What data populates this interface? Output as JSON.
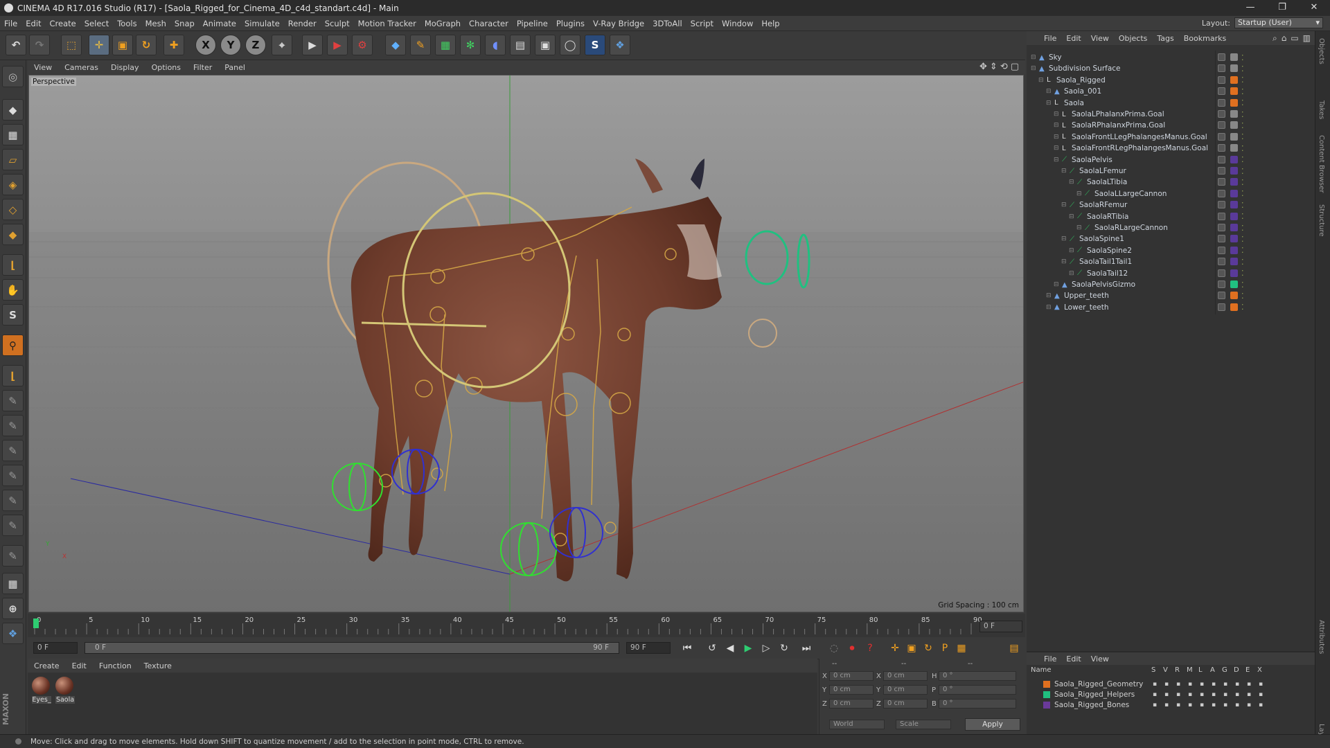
{
  "window": {
    "title": "CINEMA 4D R17.016 Studio (R17) - [Saola_Rigged_for_Cinema_4D_c4d_standart.c4d] - Main"
  },
  "menu": [
    "File",
    "Edit",
    "Create",
    "Select",
    "Tools",
    "Mesh",
    "Snap",
    "Animate",
    "Simulate",
    "Render",
    "Sculpt",
    "Motion Tracker",
    "MoGraph",
    "Character",
    "Pipeline",
    "Plugins",
    "V-Ray Bridge",
    "3DToAll",
    "Script",
    "Window",
    "Help"
  ],
  "layout": {
    "label": "Layout:",
    "value": "Startup (User)"
  },
  "toolbar": {
    "x": "X",
    "y": "Y",
    "z": "Z"
  },
  "viewport": {
    "menu": [
      "View",
      "Cameras",
      "Display",
      "Options",
      "Filter",
      "Panel"
    ],
    "label": "Perspective",
    "grid_spacing": "Grid Spacing : 100 cm",
    "axis_y": "Y",
    "axis_x": "X",
    "axis_z": "Z"
  },
  "timeline": {
    "ticks": [
      "0",
      "5",
      "10",
      "15",
      "20",
      "25",
      "30",
      "35",
      "40",
      "45",
      "50",
      "55",
      "60",
      "65",
      "70",
      "75",
      "80",
      "85",
      "90"
    ],
    "current_frame": "0 F",
    "field_start": "0 F",
    "slider_start": "0 F",
    "slider_end": "90 F",
    "field_end": "90 F"
  },
  "materials": {
    "menu": [
      "Create",
      "Edit",
      "Function",
      "Texture"
    ],
    "items": [
      {
        "name": "Eyes_"
      },
      {
        "name": "Saola"
      }
    ]
  },
  "coords": {
    "header1": "--",
    "header2": "--",
    "header3": "--",
    "rows": [
      {
        "l1": "X",
        "v1": "0 cm",
        "l2": "X",
        "v2": "0 cm",
        "l3": "H",
        "v3": "0 °"
      },
      {
        "l1": "Y",
        "v1": "0 cm",
        "l2": "Y",
        "v2": "0 cm",
        "l3": "P",
        "v3": "0 °"
      },
      {
        "l1": "Z",
        "v1": "0 cm",
        "l2": "Z",
        "v2": "0 cm",
        "l3": "B",
        "v3": "0 °"
      }
    ],
    "world": "World",
    "scale": "Scale",
    "apply": "Apply"
  },
  "objects": {
    "menu": [
      "File",
      "Edit",
      "View",
      "Objects",
      "Tags",
      "Bookmarks"
    ],
    "tree": [
      {
        "name": "Sky",
        "indent": 0,
        "color": "#888888",
        "icon": "sky-icon"
      },
      {
        "name": "Subdivision Surface",
        "indent": 0,
        "color": "#888888",
        "icon": "subdivision-icon"
      },
      {
        "name": "Saola_Rigged",
        "indent": 1,
        "color": "#e07020",
        "icon": "null-icon"
      },
      {
        "name": "Saola_001",
        "indent": 2,
        "color": "#e07020",
        "icon": "polygon-icon"
      },
      {
        "name": "Saola",
        "indent": 2,
        "color": "#e07020",
        "icon": "null-icon"
      },
      {
        "name": "SaolaLPhalanxPrima.Goal",
        "indent": 3,
        "color": "#888888",
        "icon": "null-icon"
      },
      {
        "name": "SaolaRPhalanxPrima.Goal",
        "indent": 3,
        "color": "#888888",
        "icon": "null-icon"
      },
      {
        "name": "SaolaFrontLLegPhalangesManus.Goal",
        "indent": 3,
        "color": "#888888",
        "icon": "null-icon"
      },
      {
        "name": "SaolaFrontRLegPhalangesManus.Goal",
        "indent": 3,
        "color": "#888888",
        "icon": "null-icon"
      },
      {
        "name": "SaolaPelvis",
        "indent": 3,
        "color": "#5a3a9a",
        "icon": "joint-icon"
      },
      {
        "name": "SaolaLFemur",
        "indent": 4,
        "color": "#5a3a9a",
        "icon": "joint-icon"
      },
      {
        "name": "SaolaLTibia",
        "indent": 5,
        "color": "#5a3a9a",
        "icon": "joint-icon"
      },
      {
        "name": "SaolaLLargeCannon",
        "indent": 6,
        "color": "#5a3a9a",
        "icon": "joint-icon"
      },
      {
        "name": "SaolaRFemur",
        "indent": 4,
        "color": "#5a3a9a",
        "icon": "joint-icon"
      },
      {
        "name": "SaolaRTibia",
        "indent": 5,
        "color": "#5a3a9a",
        "icon": "joint-icon"
      },
      {
        "name": "SaolaRLargeCannon",
        "indent": 6,
        "color": "#5a3a9a",
        "icon": "joint-icon"
      },
      {
        "name": "SaolaSpine1",
        "indent": 4,
        "color": "#5a3a9a",
        "icon": "joint-icon"
      },
      {
        "name": "SaolaSpine2",
        "indent": 5,
        "color": "#5a3a9a",
        "icon": "joint-icon"
      },
      {
        "name": "SaolaTail1Tail1",
        "indent": 4,
        "color": "#5a3a9a",
        "icon": "joint-icon"
      },
      {
        "name": "SaolaTail12",
        "indent": 5,
        "color": "#5a3a9a",
        "icon": "joint-icon"
      },
      {
        "name": "SaolaPelvisGizmo",
        "indent": 3,
        "color": "#20c080",
        "icon": "polygon-icon"
      },
      {
        "name": "Upper_teeth",
        "indent": 2,
        "color": "#e07020",
        "icon": "polygon-icon"
      },
      {
        "name": "Lower_teeth",
        "indent": 2,
        "color": "#e07020",
        "icon": "polygon-icon"
      }
    ]
  },
  "layers": {
    "menu": [
      "File",
      "Edit",
      "View"
    ],
    "header": {
      "name": "Name",
      "cols": [
        "S",
        "V",
        "R",
        "M",
        "L",
        "A",
        "G",
        "D",
        "E",
        "X"
      ]
    },
    "items": [
      {
        "name": "Saola_Rigged_Geometry",
        "color": "#e07020"
      },
      {
        "name": "Saola_Rigged_Helpers",
        "color": "#20c080"
      },
      {
        "name": "Saola_Rigged_Bones",
        "color": "#6a3a9a"
      }
    ]
  },
  "side_tabs": [
    "Objects",
    "Takes",
    "Content Browser",
    "Structure",
    "Attributes",
    "Layers"
  ],
  "status": "Move: Click and drag to move elements. Hold down SHIFT to quantize movement / add to the selection in point mode, CTRL to remove."
}
